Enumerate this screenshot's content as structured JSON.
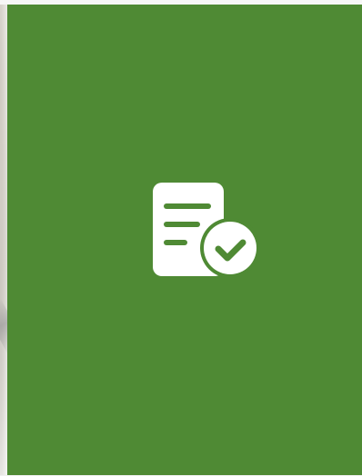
{
  "screen": {
    "background_color": "#4f8a34",
    "icon": "document-check-icon",
    "icon_color": "#ffffff"
  }
}
